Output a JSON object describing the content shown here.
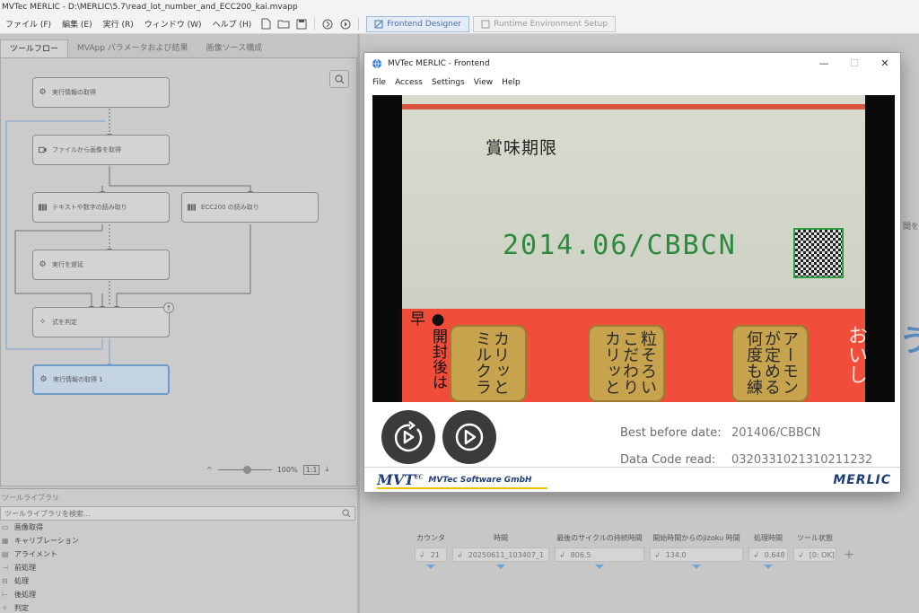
{
  "window": {
    "title": "MVTec MERLIC - D:\\MERLIC\\5.7\\read_lot_number_and_ECC200_kai.mvapp"
  },
  "menu": [
    "ファイル (F)",
    "編集 (E)",
    "実行 (R)",
    "ウィンドウ (W)",
    "ヘルプ (H)"
  ],
  "modes": {
    "frontend_designer": "Frontend Designer",
    "runtime_setup": "Runtime Environment Setup"
  },
  "tabs": [
    "ツールフロー",
    "MVApp パラメータおよび結果",
    "画像ソース構成"
  ],
  "flow": {
    "nodes": [
      {
        "label": "実行情報の取得",
        "icon": "gear-icon"
      },
      {
        "label": "ファイルから画像を取得",
        "icon": "camera-icon"
      },
      {
        "label": "テキストや数字の読み取り",
        "icon": "barcode-icon"
      },
      {
        "label": "ECC200 の読み取り",
        "icon": "barcode-icon"
      },
      {
        "label": "実行を遅延",
        "icon": "gear-icon"
      },
      {
        "label": "式を判定",
        "icon": "spark-icon"
      },
      {
        "label": "実行情報の取得 1",
        "icon": "gear-icon"
      }
    ],
    "zoom": "100%"
  },
  "library": {
    "title": "ツールライブラリ",
    "search_placeholder": "ツールライブラリを検索...",
    "items": [
      "画像取得",
      "キャリブレーション",
      "アライメント",
      "前処理",
      "処理",
      "後処理",
      "判定"
    ]
  },
  "results": {
    "columns": [
      {
        "header": "カウンタ",
        "value": "21"
      },
      {
        "header": "時間",
        "value": "20250611_103407_1"
      },
      {
        "header": "最後のサイクルの持続時間",
        "value": "806.5"
      },
      {
        "header": "開始時間からのjizoku 時間",
        "value": "134.0"
      },
      {
        "header": "処理時間",
        "value": "0.648"
      },
      {
        "header": "ツール状態",
        "value": "[0: OK]"
      }
    ]
  },
  "side_text": "間を",
  "frontend": {
    "title": "MVTec MERLIC - Frontend",
    "menu": [
      "File",
      "Access",
      "Settings",
      "View",
      "Help"
    ],
    "image": {
      "heading": "賞味期限",
      "code": "2014.06/CBBCN",
      "side_text": "●開封後は早",
      "pills": [
        "カリッと\nミルクラ",
        "粒そろい\nこだわり\nカリッと",
        "アーモン\nが定める\n何度も練"
      ],
      "edge_text": "おいし"
    },
    "best_before_label": "Best before date:",
    "best_before_value": "201406/CBBCN",
    "data_code_label": "Data Code read:",
    "data_code_value": "0320331021310211232",
    "footer_company": "MVTec Software GmbH",
    "footer_logo": "MVT",
    "footer_logo_sup": "EC",
    "footer_product": "MERLIC"
  }
}
